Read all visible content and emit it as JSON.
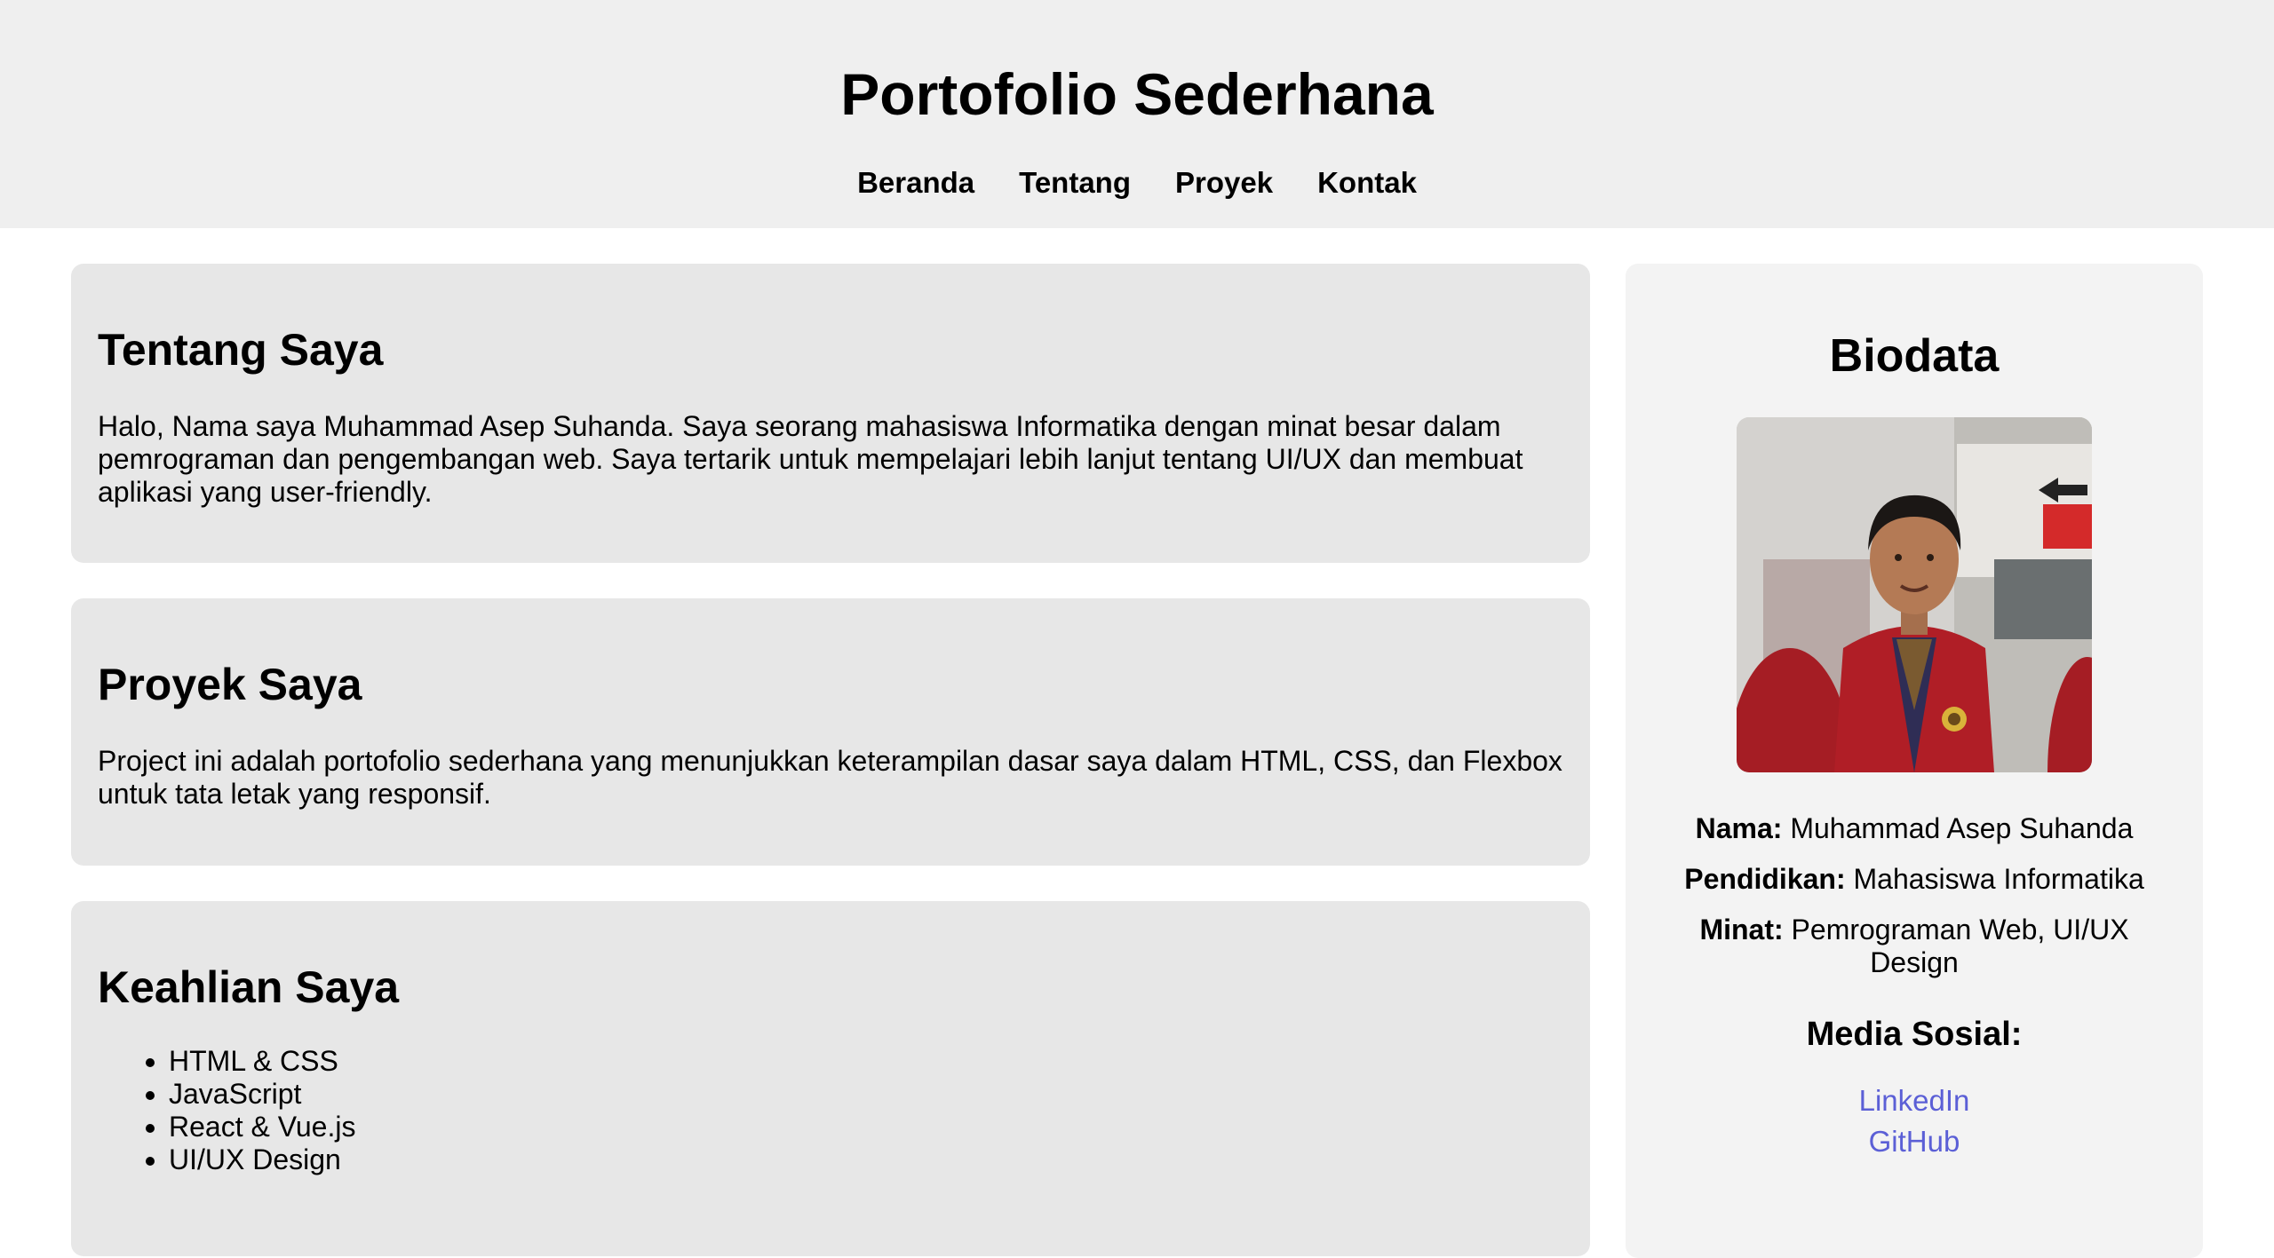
{
  "header": {
    "title": "Portofolio Sederhana",
    "nav": [
      "Beranda",
      "Tentang",
      "Proyek",
      "Kontak"
    ]
  },
  "sections": {
    "about": {
      "title": "Tentang Saya",
      "text": "Halo, Nama saya Muhammad Asep Suhanda. Saya seorang mahasiswa Informatika dengan minat besar dalam pemrograman dan pengembangan web. Saya tertarik untuk mempelajari lebih lanjut tentang UI/UX dan membuat aplikasi yang user-friendly."
    },
    "projects": {
      "title": "Proyek Saya",
      "text": "Project ini adalah portofolio sederhana yang menunjukkan keterampilan dasar saya dalam HTML, CSS, dan Flexbox untuk tata letak yang responsif."
    },
    "skills": {
      "title": "Keahlian Saya",
      "items": [
        "HTML & CSS",
        "JavaScript",
        "React & Vue.js",
        "UI/UX Design"
      ]
    }
  },
  "sidebar": {
    "title": "Biodata",
    "photo_icon": "profile-photo",
    "name_label": "Nama:",
    "name_value": " Muhammad Asep Suhanda",
    "education_label": "Pendidikan:",
    "education_value": " Mahasiswa Informatika",
    "interest_label": "Minat:",
    "interest_value": " Pemrograman Web, UI/UX Design",
    "social_title": "Media Sosial:",
    "links": [
      "LinkedIn",
      "GitHub"
    ],
    "link_color": "#5b5fd6"
  }
}
